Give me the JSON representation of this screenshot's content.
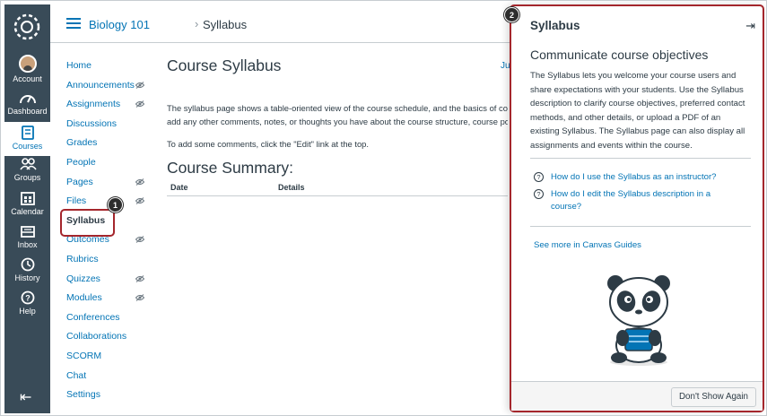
{
  "breadcrumb": {
    "course": "Biology 101",
    "separator": "›",
    "current": "Syllabus"
  },
  "global_nav": [
    {
      "label": "Account",
      "icon": "avatar"
    },
    {
      "label": "Dashboard",
      "icon": "dashboard-icon"
    },
    {
      "label": "Courses",
      "icon": "courses-icon",
      "active": true
    },
    {
      "label": "Groups",
      "icon": "groups-icon"
    },
    {
      "label": "Calendar",
      "icon": "calendar-icon"
    },
    {
      "label": "Inbox",
      "icon": "inbox-icon"
    },
    {
      "label": "History",
      "icon": "history-icon"
    },
    {
      "label": "Help",
      "icon": "help-icon"
    }
  ],
  "course_nav": [
    {
      "label": "Home",
      "hidden": false
    },
    {
      "label": "Announcements",
      "hidden": true
    },
    {
      "label": "Assignments",
      "hidden": true
    },
    {
      "label": "Discussions",
      "hidden": false
    },
    {
      "label": "Grades",
      "hidden": false
    },
    {
      "label": "People",
      "hidden": false
    },
    {
      "label": "Pages",
      "hidden": true
    },
    {
      "label": "Files",
      "hidden": true
    },
    {
      "label": "Syllabus",
      "hidden": false,
      "active": true
    },
    {
      "label": "Outcomes",
      "hidden": true
    },
    {
      "label": "Rubrics",
      "hidden": false
    },
    {
      "label": "Quizzes",
      "hidden": true
    },
    {
      "label": "Modules",
      "hidden": true
    },
    {
      "label": "Conferences",
      "hidden": false
    },
    {
      "label": "Collaborations",
      "hidden": false
    },
    {
      "label": "SCORM",
      "hidden": false
    },
    {
      "label": "Chat",
      "hidden": false
    },
    {
      "label": "Settings",
      "hidden": false
    }
  ],
  "main": {
    "title": "Course Syllabus",
    "jump_link": "Ju",
    "para1_line1": "The syllabus page shows a table-oriented view of the course schedule, and the basics of cou",
    "para1_line2": "add any other comments, notes, or thoughts you have about the course structure, course po",
    "para2": "To add some comments, click the \"Edit\" link at the top.",
    "summary_title": "Course Summary:",
    "col_date": "Date",
    "col_details": "Details"
  },
  "callouts": {
    "one": "1",
    "two": "2"
  },
  "tray": {
    "title": "Syllabus",
    "subtitle": "Communicate course objectives",
    "description": "The Syllabus lets you welcome your course users and share expectations with your students. Use the Syllabus description to clarify course objectives, preferred contact methods, and other details, or upload a PDF of an existing Syllabus. The Syllabus page can also display all assignments and events within the course.",
    "links": [
      "How do I use the Syllabus as an instructor?",
      "How do I edit the Syllabus description in a course?"
    ],
    "help_glyph": "?",
    "see_more": "See more in Canvas Guides",
    "dont_show": "Don't Show Again"
  },
  "colors": {
    "nav_bg": "#394b58",
    "link": "#0374b5",
    "highlight": "#a4262c"
  }
}
